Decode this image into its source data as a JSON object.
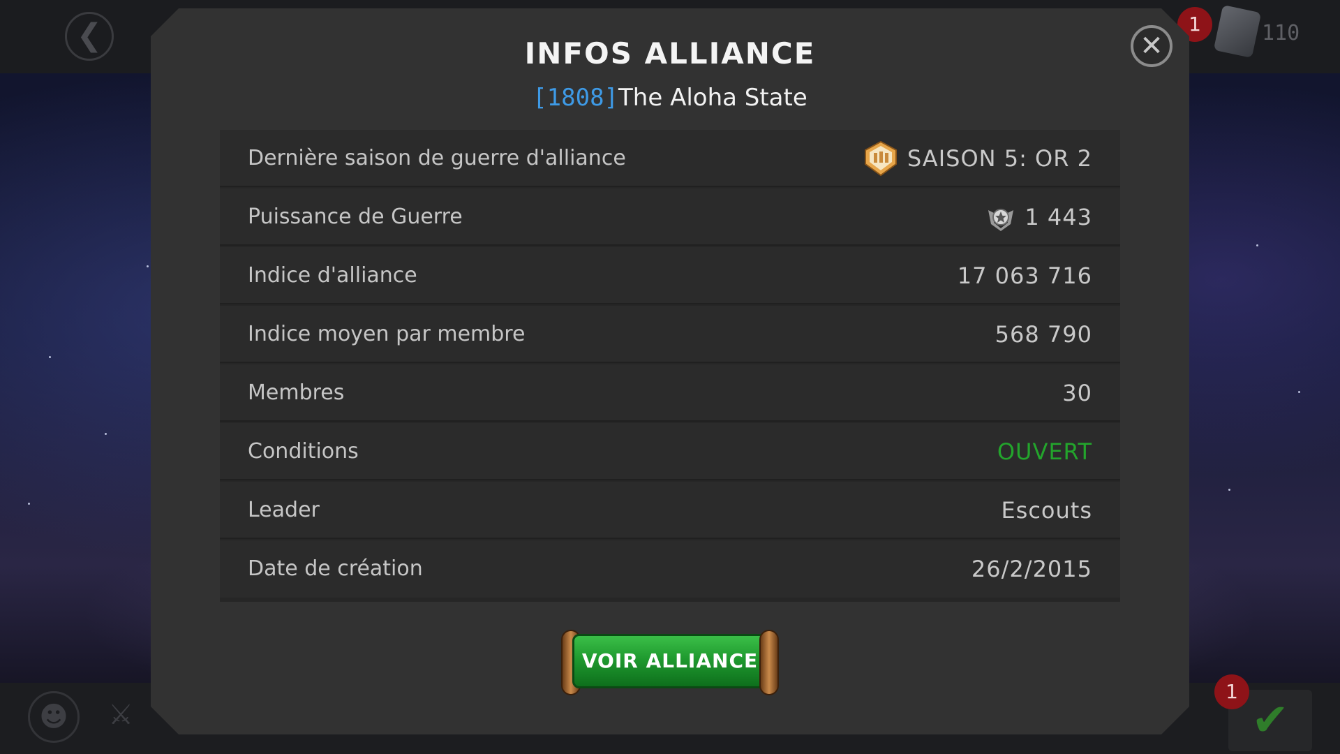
{
  "hud": {
    "notification_badge": "1",
    "card_count": "110",
    "quests_badge": "1"
  },
  "modal": {
    "title": "INFOS ALLIANCE",
    "alliance_tag": "[1808]",
    "alliance_name": "The Aloha State",
    "rows": [
      {
        "label": "Dernière saison de guerre d'alliance",
        "value": "SAISON 5: OR 2",
        "icon": "gold-shield-icon"
      },
      {
        "label": "Puissance de Guerre",
        "value": "1 443",
        "icon": "war-rating-star-icon"
      },
      {
        "label": "Indice d'alliance",
        "value": "17 063 716"
      },
      {
        "label": "Indice moyen par membre",
        "value": "568 790"
      },
      {
        "label": "Membres",
        "value": "30"
      },
      {
        "label": "Conditions",
        "value": "OUVERT",
        "value_color": "#23a52c"
      },
      {
        "label": "Leader",
        "value": "Escouts"
      },
      {
        "label": "Date de création",
        "value": "26/2/2015"
      }
    ],
    "button_label": "VOIR ALLIANCE"
  },
  "colors": {
    "accent_blue": "#3e9ae6",
    "status_green": "#23a52c",
    "button_green": "#1f9a2f"
  }
}
